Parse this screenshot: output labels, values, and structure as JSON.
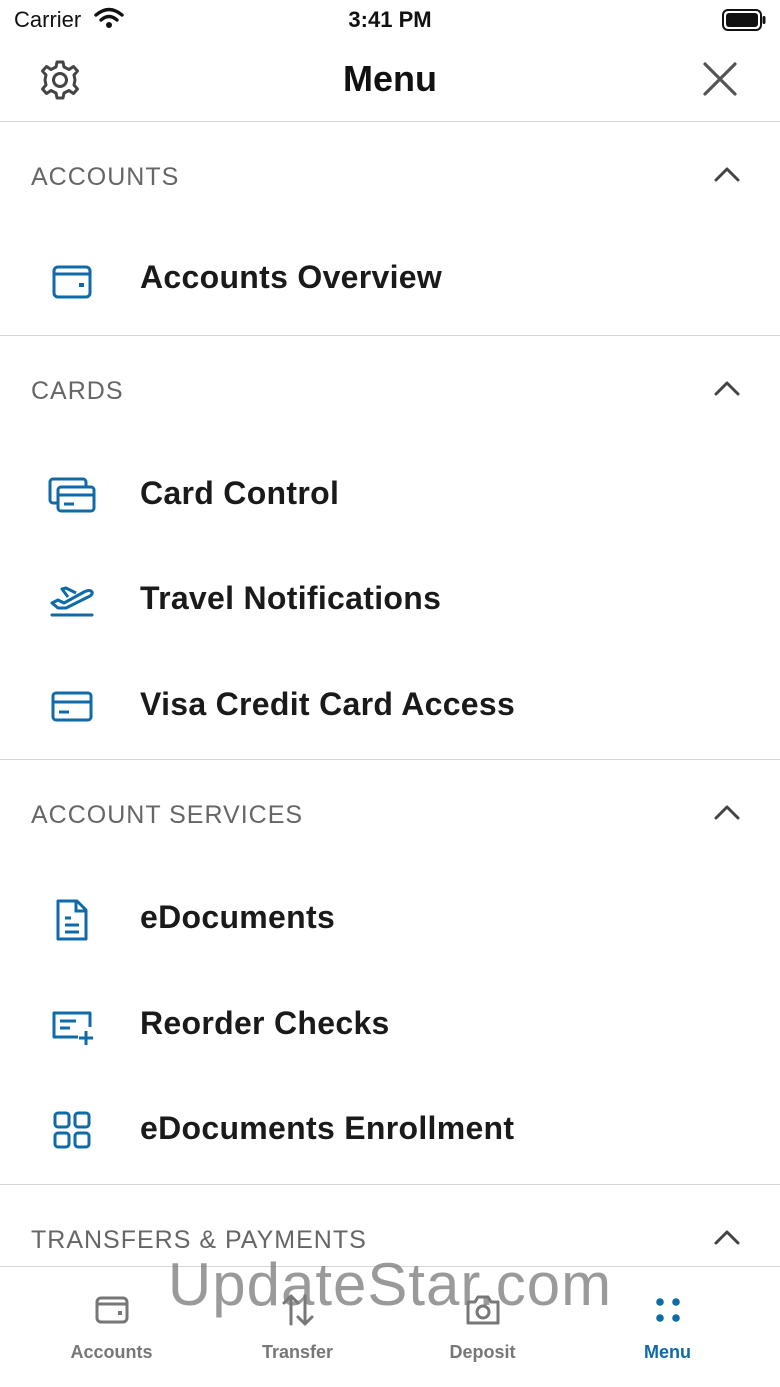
{
  "status_bar": {
    "carrier": "Carrier",
    "time": "3:41 PM"
  },
  "header": {
    "title": "Menu"
  },
  "colors": {
    "accent": "#0f6aa8",
    "text": "#1a1a1a",
    "muted": "#666666",
    "divider": "#d6d6d6"
  },
  "sections": [
    {
      "title": "ACCOUNTS",
      "items": [
        {
          "label": "Accounts Overview",
          "icon": "wallet-icon"
        }
      ]
    },
    {
      "title": "CARDS",
      "items": [
        {
          "label": "Card Control",
          "icon": "cards-icon"
        },
        {
          "label": "Travel Notifications",
          "icon": "airplane-icon"
        },
        {
          "label": "Visa Credit Card Access",
          "icon": "credit-card-icon"
        }
      ]
    },
    {
      "title": "ACCOUNT SERVICES",
      "items": [
        {
          "label": "eDocuments",
          "icon": "document-icon"
        },
        {
          "label": "Reorder Checks",
          "icon": "check-add-icon"
        },
        {
          "label": "eDocuments Enrollment",
          "icon": "grid-icon"
        }
      ]
    },
    {
      "title": "TRANSFERS & PAYMENTS",
      "items": []
    }
  ],
  "tab_bar": [
    {
      "label": "Accounts",
      "icon": "wallet-icon"
    },
    {
      "label": "Transfer",
      "icon": "transfer-arrows-icon"
    },
    {
      "label": "Deposit",
      "icon": "camera-icon"
    },
    {
      "label": "Menu",
      "icon": "dots-grid-icon",
      "active": true
    }
  ],
  "watermark": "UpdateStar.com"
}
